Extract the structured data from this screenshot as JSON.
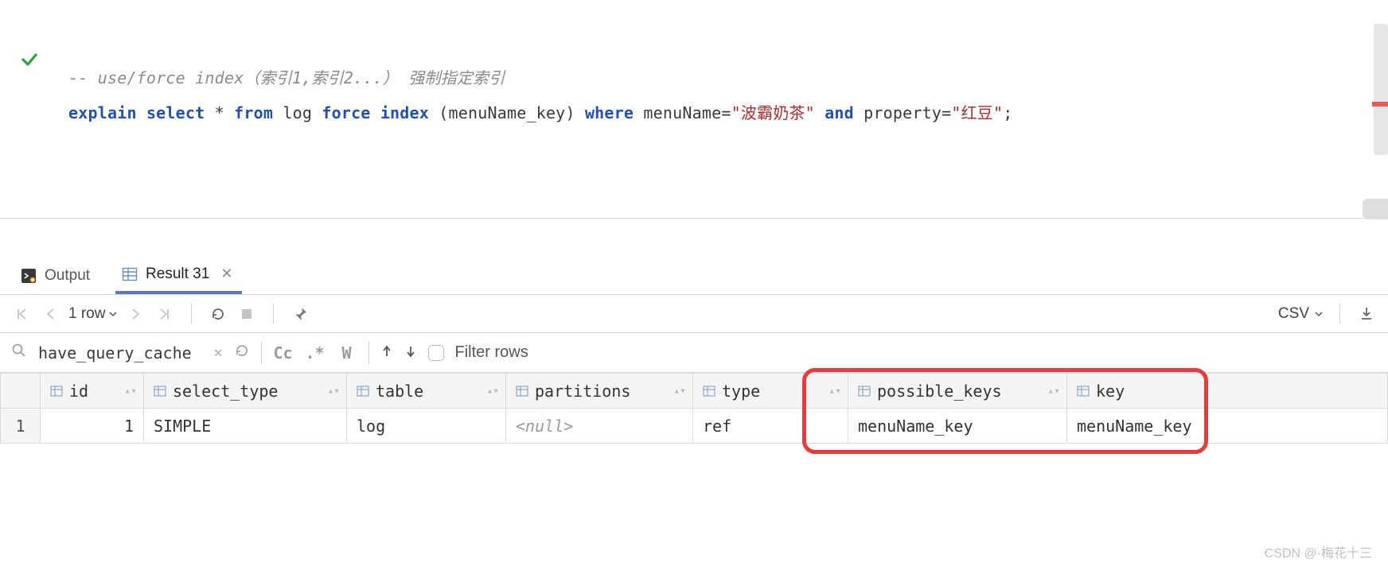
{
  "sql": {
    "comment": "-- use/force index（索引1,索引2...） 强制指定索引",
    "tokens": {
      "explain": "explain",
      "select": "select",
      "star": "*",
      "from": "from",
      "tablename": "log",
      "force": "force",
      "index": "index",
      "lparen": "(",
      "idxname": "menuName_key",
      "rparen": ")",
      "where": "where",
      "col1": "menuName",
      "eq": "=",
      "str1": "\"波霸奶茶\"",
      "and": "and",
      "col2": "property",
      "str2": "\"红豆\"",
      "semi": ";"
    }
  },
  "tabs": {
    "output_label": "Output",
    "result_label": "Result 31"
  },
  "toolbar": {
    "row_count": "1 row",
    "csv_label": "CSV"
  },
  "filter": {
    "search_value": "have_query_cache",
    "cc_label": "Cc",
    "regex_label": ".*",
    "word_label": "W",
    "filter_placeholder": "Filter rows"
  },
  "columns": [
    "id",
    "select_type",
    "table",
    "partitions",
    "type",
    "possible_keys",
    "key"
  ],
  "rows": [
    {
      "rownum": "1",
      "id": "1",
      "select_type": "SIMPLE",
      "table": "log",
      "partitions": "<null>",
      "type": "ref",
      "possible_keys": "menuName_key",
      "key": "menuName_key"
    }
  ],
  "watermark": "CSDN @·梅花十三"
}
